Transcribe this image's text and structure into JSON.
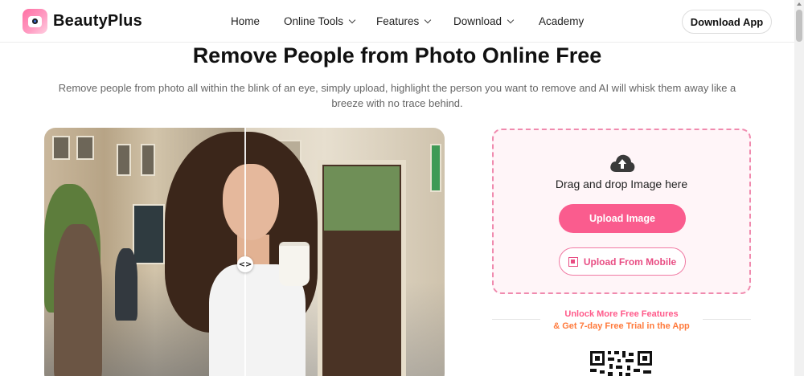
{
  "brand": {
    "name": "BeautyPlus",
    "logo_icon": "camera-icon"
  },
  "nav": {
    "items": [
      {
        "label": "Home",
        "has_dropdown": false
      },
      {
        "label": "Online Tools",
        "has_dropdown": true
      },
      {
        "label": "Features",
        "has_dropdown": true
      },
      {
        "label": "Download",
        "has_dropdown": true
      },
      {
        "label": "Academy",
        "has_dropdown": false
      }
    ],
    "cta_label": "Download App"
  },
  "hero": {
    "title": "Remove People from Photo Online Free",
    "subtitle": "Remove people from photo all within the blink of an eye, simply upload, highlight the person you want to remove and AI will whisk them away like a breeze with no trace behind."
  },
  "compare": {
    "handle_glyph": "<>"
  },
  "upload": {
    "icon": "cloud-upload-icon",
    "drag_text": "Drag and drop Image here",
    "upload_button": "Upload Image",
    "mobile_button": "Upload From Mobile",
    "mobile_icon": "qr-code-icon"
  },
  "promo": {
    "line1": "Unlock More Free Features",
    "line2": "& Get 7-day Free Trial in the App"
  },
  "colors": {
    "accent_pink": "#fa5c8e",
    "promo_orange": "#ff7a3c",
    "upload_border": "#f08aae",
    "upload_bg": "#fff5f8"
  }
}
